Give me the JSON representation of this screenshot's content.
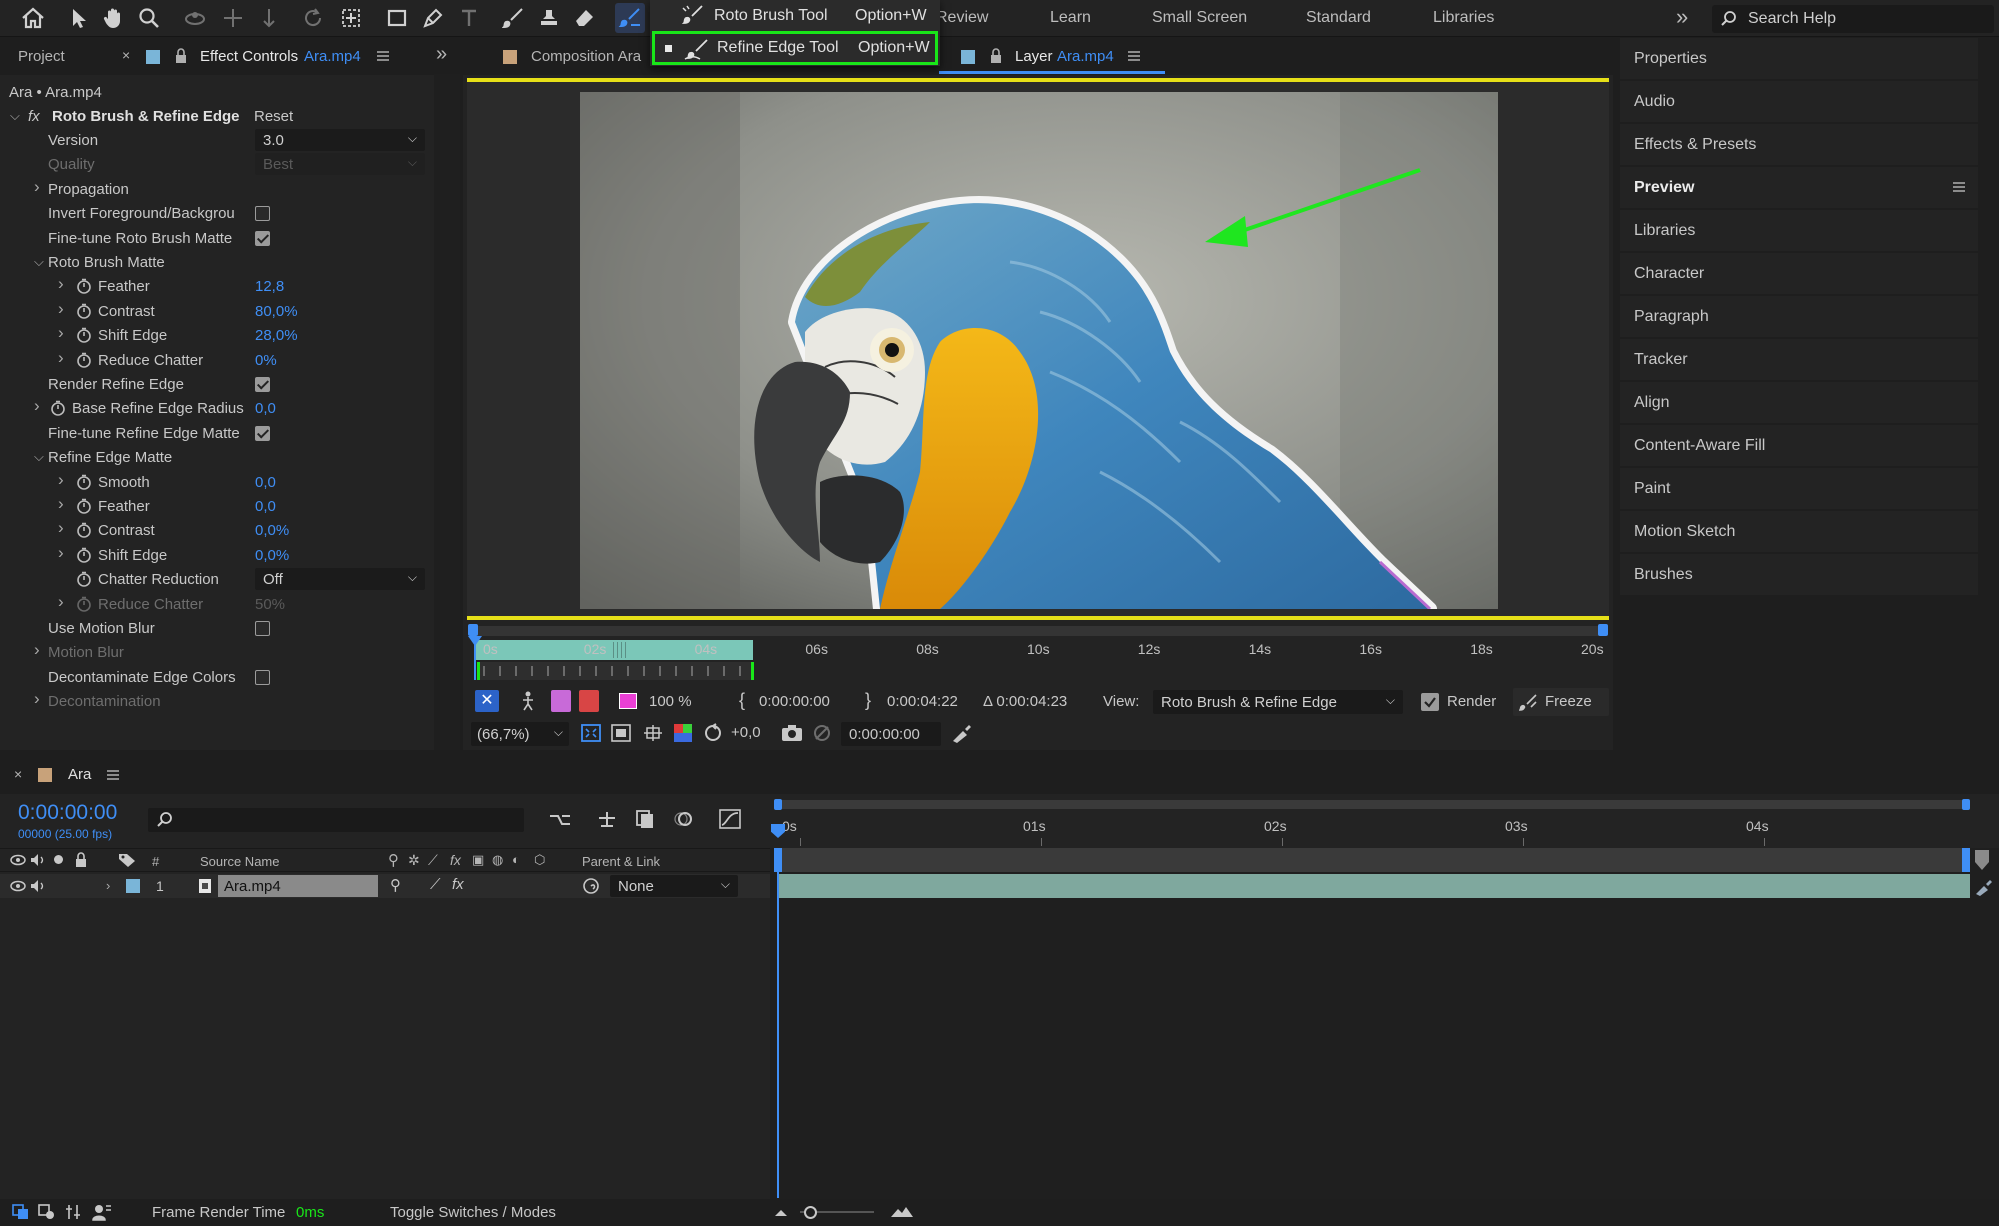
{
  "toolbar": {
    "workspaces": [
      "Review",
      "Learn",
      "Small Screen",
      "Standard",
      "Libraries"
    ],
    "more_label": "»",
    "search_placeholder": "Search Help"
  },
  "tool_menu": {
    "items": [
      {
        "label": "Roto Brush Tool",
        "shortcut": "Option+W",
        "selected": false
      },
      {
        "label": "Refine Edge Tool",
        "shortcut": "Option+W",
        "selected": true
      }
    ]
  },
  "left_panel": {
    "tab_project": "Project",
    "tab_effect_controls": "Effect Controls",
    "tab_file": "Ara.mp4",
    "breadcrumb": "Ara • Ara.mp4",
    "effect_name": "Roto Brush & Refine Edge",
    "reset_label": "Reset",
    "rows": [
      {
        "label": "Version",
        "type": "dropdown",
        "value": "3.0"
      },
      {
        "label": "Quality",
        "type": "dropdown",
        "value": "Best",
        "disabled": true
      },
      {
        "label": "Propagation",
        "type": "group"
      },
      {
        "label": "Invert Foreground/Backgrou",
        "type": "checkbox",
        "checked": false
      },
      {
        "label": "Fine-tune Roto Brush Matte",
        "type": "checkbox",
        "checked": true
      },
      {
        "label": "Roto Brush Matte",
        "type": "group-open"
      },
      {
        "label": "Feather",
        "value": "12,8"
      },
      {
        "label": "Contrast",
        "value": "80,0%"
      },
      {
        "label": "Shift Edge",
        "value": "28,0%"
      },
      {
        "label": "Reduce Chatter",
        "value": "0%"
      },
      {
        "label": "Render Refine Edge",
        "type": "checkbox",
        "checked": true
      },
      {
        "label": "Base Refine Edge Radius",
        "value": "0,0"
      },
      {
        "label": "Fine-tune Refine Edge Matte",
        "type": "checkbox",
        "checked": true
      },
      {
        "label": "Refine Edge Matte",
        "type": "group-open"
      },
      {
        "label": "Smooth",
        "value": "0,0"
      },
      {
        "label": "Feather",
        "value": "0,0"
      },
      {
        "label": "Contrast",
        "value": "0,0%"
      },
      {
        "label": "Shift Edge",
        "value": "0,0%"
      },
      {
        "label": "Chatter Reduction",
        "type": "dropdown",
        "value": "Off"
      },
      {
        "label": "Reduce Chatter",
        "value": "50%",
        "disabled": true
      },
      {
        "label": "Use Motion Blur",
        "type": "checkbox",
        "checked": false
      },
      {
        "label": "Motion Blur",
        "type": "group",
        "disabled": true
      },
      {
        "label": "Decontaminate Edge Colors",
        "type": "checkbox",
        "checked": false
      },
      {
        "label": "Decontamination",
        "type": "group",
        "disabled": true
      }
    ]
  },
  "viewer": {
    "tab_composition": "Composition Ara",
    "tab_layer": "Layer",
    "tab_layer_file": "Ara.mp4",
    "ruler_labels": [
      "0s",
      "02s",
      "04s",
      "06s",
      "08s",
      "10s",
      "12s",
      "14s",
      "16s",
      "18s",
      "20s"
    ],
    "zoom_percent": "100 %",
    "time_in": "0:00:00:00",
    "time_out": "0:00:04:22",
    "time_duration": "Δ 0:00:04:23",
    "view_label": "View:",
    "view_value": "Roto Brush & Refine Edge",
    "render_label": "Render",
    "freeze_label": "Freeze",
    "magnification": "(66,7%)",
    "exposure": "+0,0",
    "current_time": "0:00:00:00"
  },
  "right_panel": {
    "items": [
      "Properties",
      "Audio",
      "Effects & Presets",
      "Preview",
      "Libraries",
      "Character",
      "Paragraph",
      "Tracker",
      "Align",
      "Content-Aware Fill",
      "Paint",
      "Motion Sketch",
      "Brushes"
    ]
  },
  "timeline": {
    "tab_name": "Ara",
    "timecode": "0:00:00:00",
    "frame_info": "00000 (25.00 fps)",
    "col_number": "#",
    "col_source": "Source Name",
    "col_parent": "Parent & Link",
    "layer_number": "1",
    "layer_name": "Ara.mp4",
    "layer_parent": "None",
    "ruler_labels": [
      "0s",
      "01s",
      "02s",
      "03s",
      "04s"
    ]
  },
  "statusbar": {
    "frame_render_label": "Frame Render Time",
    "frame_render_value": "0ms",
    "toggle_label": "Toggle Switches / Modes"
  },
  "colors": {
    "accent_blue": "#3f8ef5",
    "highlight_green": "#19e619",
    "work_area_yellow": "#e6e018",
    "layer_bar": "#7fa89e"
  }
}
